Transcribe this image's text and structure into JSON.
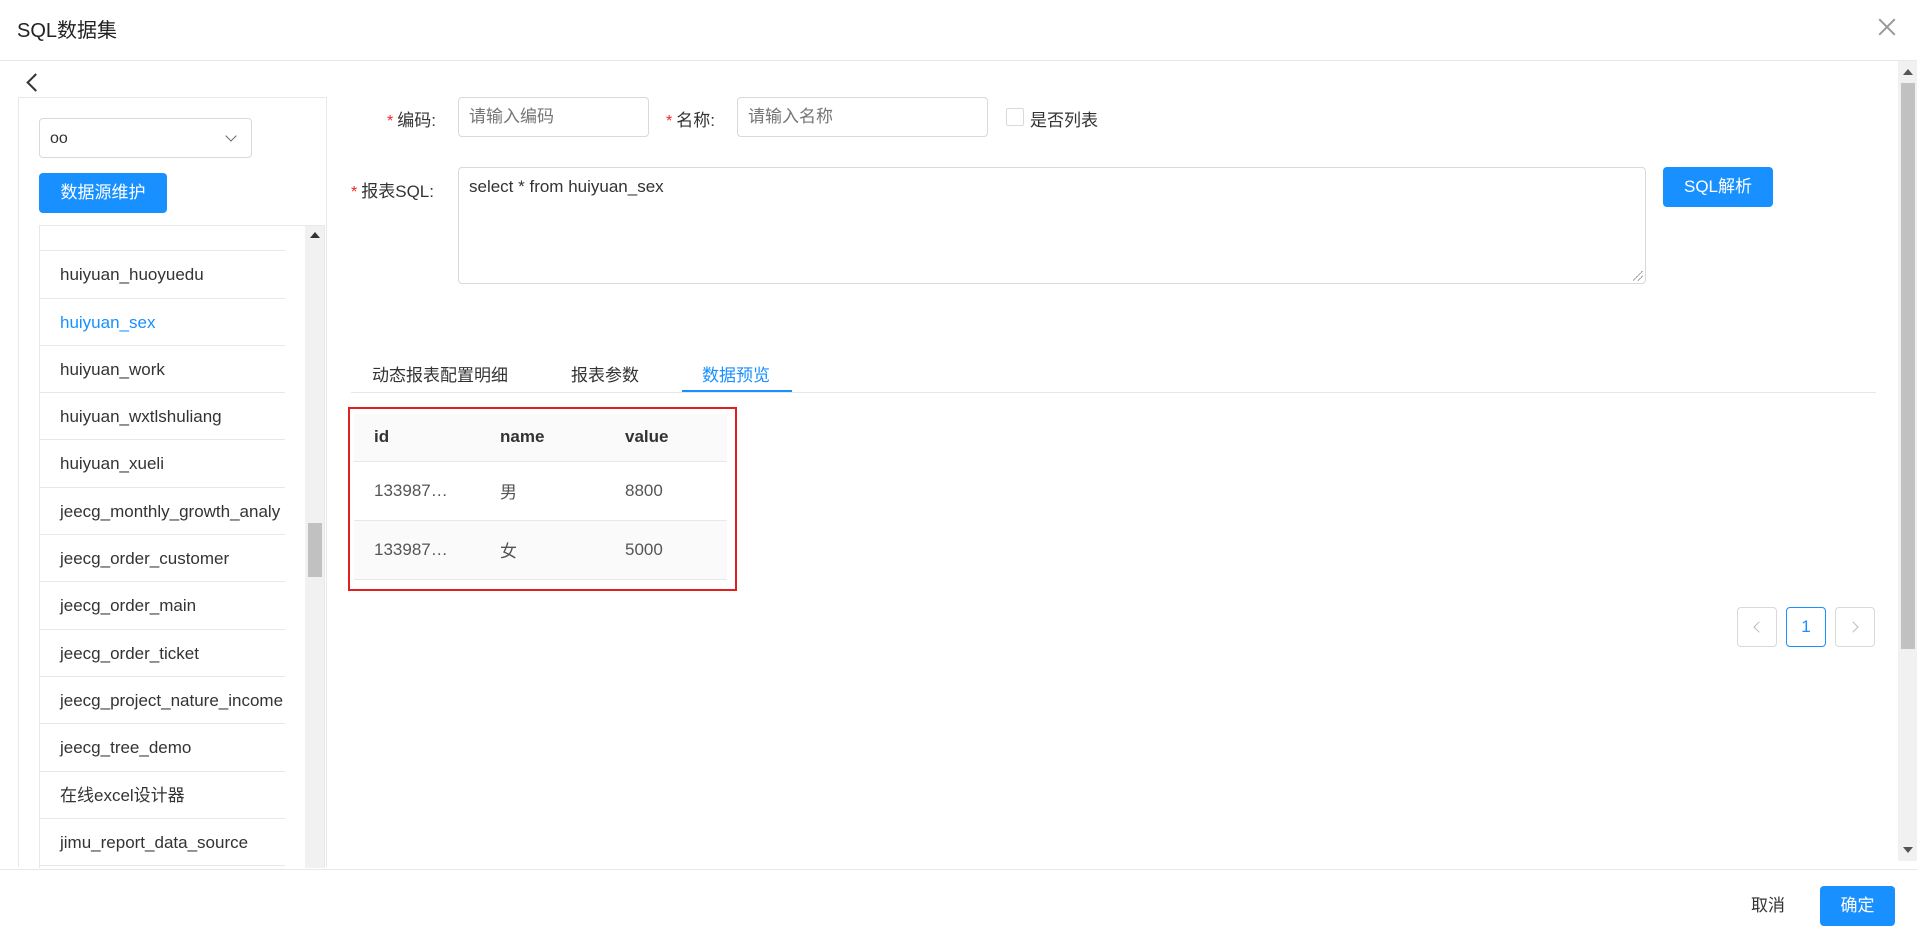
{
  "dialog": {
    "title": "SQL数据集"
  },
  "sidebar": {
    "datasource_value": "oo",
    "datasource_button": "数据源维护",
    "tables": [
      "huiyuan_huoyuedu",
      "huiyuan_sex",
      "huiyuan_work",
      "huiyuan_wxtlshuliang",
      "huiyuan_xueli",
      "jeecg_monthly_growth_analy",
      "jeecg_order_customer",
      "jeecg_order_main",
      "jeecg_order_ticket",
      "jeecg_project_nature_income",
      "jeecg_tree_demo",
      "在线excel设计器",
      "jimu_report_data_source"
    ],
    "active_table": "huiyuan_sex"
  },
  "form": {
    "code_label": "编码:",
    "code_placeholder": "请输入编码",
    "name_label": "名称:",
    "name_placeholder": "请输入名称",
    "is_list_label": "是否列表",
    "sql_label": "报表SQL:",
    "sql_value": "select *  from huiyuan_sex",
    "sql_parse_button": "SQL解析"
  },
  "tabs": [
    "动态报表配置明细",
    "报表参数",
    "数据预览"
  ],
  "active_tab": "数据预览",
  "preview": {
    "columns": [
      "id",
      "name",
      "value"
    ],
    "rows": [
      [
        "133987…",
        "男",
        "8800"
      ],
      [
        "133987…",
        "女",
        "5000"
      ]
    ]
  },
  "pagination": {
    "current": "1"
  },
  "footer": {
    "cancel": "取消",
    "ok": "确定"
  }
}
